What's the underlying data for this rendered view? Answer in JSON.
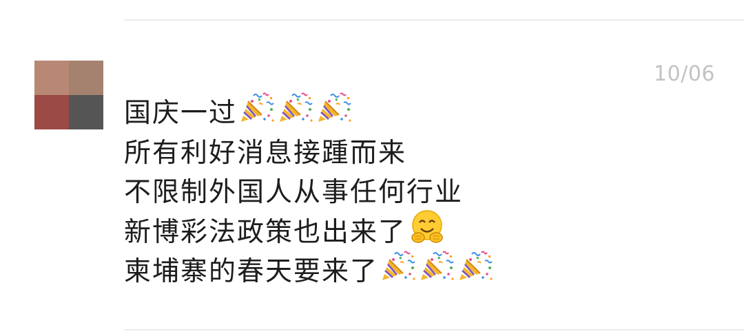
{
  "message": {
    "timestamp": "10/06",
    "lines": [
      "国庆一过",
      "所有利好消息接踵而来",
      "不限制外国人从事任何行业",
      "新博彩法政策也出来了",
      "柬埔寨的春天要来了"
    ],
    "line_emojis": [
      [
        "party-popper-icon",
        "party-popper-icon",
        "party-popper-icon"
      ],
      [],
      [],
      [
        "hugging-face-icon"
      ],
      [
        "party-popper-icon",
        "party-popper-icon",
        "party-popper-icon"
      ]
    ]
  },
  "avatar": {
    "pixel_colors": [
      "#b88874",
      "#a58270",
      "#9b4a46",
      "#555555"
    ]
  },
  "colors": {
    "text": "#1d1d1d",
    "timestamp": "#c2c2c2",
    "divider": "#ececec",
    "background": "#ffffff"
  }
}
